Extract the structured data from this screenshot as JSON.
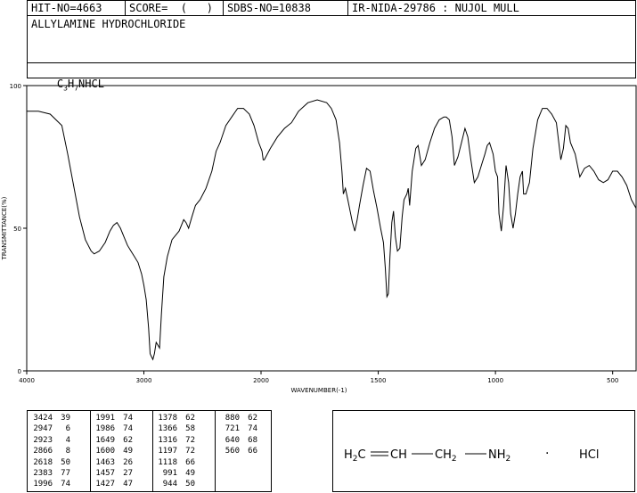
{
  "header": {
    "hit_no": "HIT-NO=4663",
    "score": "SCORE=  (   )",
    "sdbs_no": "SDBS-NO=10838",
    "ir_info": "IR-NIDA-29786 : NUJOL MULL"
  },
  "compound": {
    "name": "ALLYLAMINE HYDROCHLORIDE",
    "formula_c": "C",
    "formula_c_sub": "3",
    "formula_h": "H",
    "formula_h_sub": "7",
    "formula_rest": "NHCL"
  },
  "structure": {
    "h2c": "H",
    "h2c_sub": "2",
    "h2c_c": "C",
    "ch": "CH",
    "ch2": "CH",
    "ch2_sub": "2",
    "nh2": "NH",
    "nh2_sub": "2",
    "dot": "·",
    "hcl": "HCl"
  },
  "peaks": [
    {
      "w": "3424",
      "t": "39"
    },
    {
      "w": "2947",
      "t": "6"
    },
    {
      "w": "2923",
      "t": "4"
    },
    {
      "w": "2866",
      "t": "8"
    },
    {
      "w": "2618",
      "t": "50"
    },
    {
      "w": "2383",
      "t": "77"
    },
    {
      "w": "1996",
      "t": "74"
    },
    {
      "w": "1991",
      "t": "74"
    },
    {
      "w": "1986",
      "t": "74"
    },
    {
      "w": "1649",
      "t": "62"
    },
    {
      "w": "1600",
      "t": "49"
    },
    {
      "w": "1463",
      "t": "26"
    },
    {
      "w": "1457",
      "t": "27"
    },
    {
      "w": "1427",
      "t": "47"
    },
    {
      "w": "1378",
      "t": "62"
    },
    {
      "w": "1366",
      "t": "58"
    },
    {
      "w": "1316",
      "t": "72"
    },
    {
      "w": "1197",
      "t": "72"
    },
    {
      "w": "1118",
      "t": "66"
    },
    {
      "w": "991",
      "t": "49"
    },
    {
      "w": "944",
      "t": "50"
    },
    {
      "w": "880",
      "t": "62"
    },
    {
      "w": "721",
      "t": "74"
    },
    {
      "w": "640",
      "t": "68"
    },
    {
      "w": "560",
      "t": "66"
    }
  ],
  "chart_data": {
    "type": "line",
    "xlabel": "WAVENUMBER(-1)",
    "ylabel": "TRANSMITTANCE(%)",
    "xlim": [
      4000,
      400
    ],
    "ylim": [
      0,
      100
    ],
    "x_ticks": [
      "4000",
      "3000",
      "2000",
      "1500",
      "1000",
      "500"
    ],
    "x_tick_values": [
      4000,
      3000,
      2000,
      1500,
      1000,
      500
    ],
    "y_ticks": [
      "0",
      "50",
      "100"
    ],
    "y_tick_values": [
      0,
      50,
      100
    ],
    "grid": false,
    "series": [
      {
        "x": [
          4000,
          3900,
          3800,
          3700,
          3650,
          3600,
          3550,
          3500,
          3450,
          3424,
          3380,
          3330,
          3290,
          3260,
          3230,
          3200,
          3170,
          3140,
          3110,
          3080,
          3050,
          3020,
          3000,
          2980,
          2960,
          2947,
          2935,
          2923,
          2910,
          2895,
          2880,
          2866,
          2850,
          2830,
          2800,
          2760,
          2700,
          2660,
          2640,
          2618,
          2590,
          2560,
          2520,
          2470,
          2420,
          2383,
          2350,
          2300,
          2250,
          2200,
          2150,
          2100,
          2060,
          2020,
          1996,
          1991,
          1986,
          1960,
          1930,
          1900,
          1870,
          1840,
          1800,
          1760,
          1720,
          1700,
          1680,
          1665,
          1655,
          1649,
          1640,
          1630,
          1620,
          1610,
          1600,
          1590,
          1580,
          1565,
          1550,
          1535,
          1520,
          1505,
          1490,
          1478,
          1470,
          1463,
          1457,
          1450,
          1442,
          1435,
          1427,
          1418,
          1408,
          1398,
          1390,
          1378,
          1372,
          1366,
          1355,
          1340,
          1330,
          1316,
          1300,
          1280,
          1260,
          1240,
          1220,
          1210,
          1197,
          1185,
          1175,
          1160,
          1145,
          1130,
          1118,
          1105,
          1090,
          1075,
          1060,
          1045,
          1035,
          1025,
          1010,
          1000,
          991,
          985,
          975,
          965,
          955,
          944,
          935,
          925,
          915,
          905,
          895,
          885,
          880,
          870,
          855,
          840,
          820,
          800,
          780,
          760,
          740,
          730,
          721,
          710,
          700,
          690,
          680,
          660,
          645,
          640,
          620,
          600,
          580,
          560,
          540,
          520,
          500,
          480,
          460,
          440,
          420,
          400
        ],
        "y": [
          91,
          91,
          90,
          86,
          76,
          65,
          54,
          46,
          42,
          41,
          42,
          45,
          49,
          51,
          52,
          50,
          47,
          44,
          42,
          40,
          38,
          34,
          30,
          25,
          15,
          6,
          5,
          4,
          6,
          10,
          9,
          8,
          20,
          33,
          40,
          46,
          49,
          53,
          52,
          50,
          54,
          58,
          60,
          64,
          70,
          77,
          80,
          86,
          89,
          92,
          92,
          90,
          86,
          80,
          77,
          74,
          74,
          78,
          82,
          85,
          87,
          91,
          94,
          95,
          94,
          92,
          88,
          80,
          70,
          62,
          64,
          60,
          56,
          52,
          49,
          53,
          58,
          65,
          71,
          70,
          63,
          57,
          50,
          45,
          36,
          26,
          27,
          40,
          52,
          56,
          47,
          42,
          43,
          54,
          60,
          62,
          64,
          58,
          70,
          78,
          79,
          72,
          74,
          80,
          85,
          88,
          89,
          89,
          88,
          82,
          72,
          75,
          80,
          85,
          82,
          74,
          66,
          68,
          72,
          76,
          79,
          80,
          76,
          70,
          68,
          55,
          49,
          58,
          72,
          66,
          55,
          50,
          55,
          62,
          68,
          70,
          62,
          62,
          66,
          78,
          88,
          92,
          92,
          90,
          87,
          80,
          74,
          78,
          86,
          85,
          80,
          76,
          70,
          68,
          71,
          72,
          70,
          67,
          66,
          67,
          70,
          70,
          68,
          65,
          60,
          57
        ]
      }
    ]
  }
}
